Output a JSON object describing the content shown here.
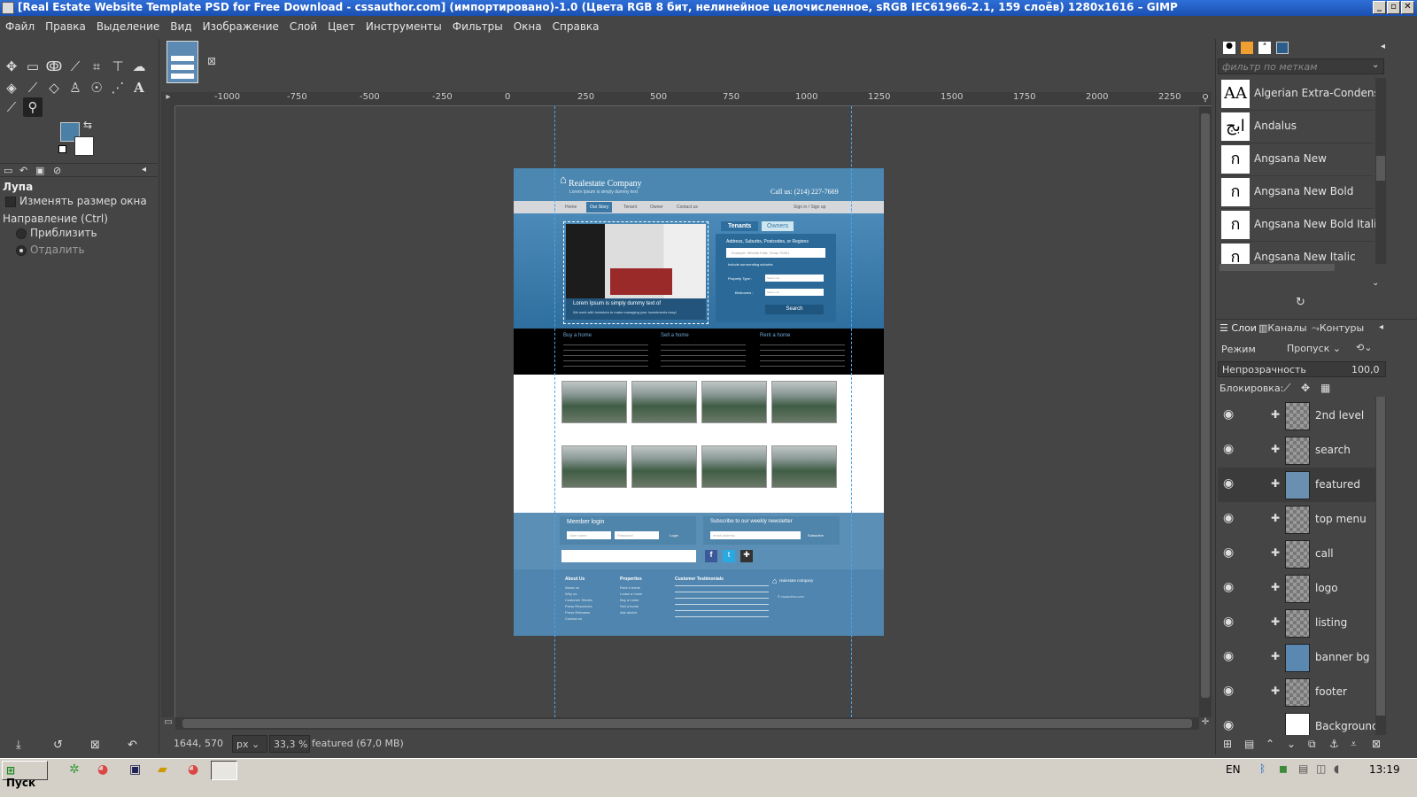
{
  "window": {
    "title": "[Real Estate Website Template PSD for Free Download - cssauthor.com] (импортировано)-1.0 (Цвета RGB 8 бит, нелинейное целочисленное, sRGB IEC61966-2.1, 159 слоёв) 1280x1616 – GIMP",
    "minimize_icon": "minimize-icon",
    "maximize_icon": "maximize-icon",
    "close_icon": "close-icon"
  },
  "menu": [
    "Файл",
    "Правка",
    "Выделение",
    "Вид",
    "Изображение",
    "Слой",
    "Цвет",
    "Инструменты",
    "Фильтры",
    "Окна",
    "Справка"
  ],
  "toolbox": {
    "colors": {
      "foreground": "#4a7fa6",
      "background": "#ffffff"
    }
  },
  "tool_options": {
    "title": "Лупа",
    "resize_window": "Изменять размер окна",
    "direction_label": "Направление  (Ctrl)",
    "zoom_in": "Приблизить",
    "zoom_out": "Отдалить"
  },
  "ruler": {
    "h_ticks": [
      "-1000",
      "-750",
      "-500",
      "-250",
      "0",
      "250",
      "500",
      "750",
      "1000",
      "1250",
      "1500",
      "1750",
      "2000",
      "2250"
    ]
  },
  "status": {
    "coords": "1644, 570",
    "unit": "px",
    "zoom": "33,3 %",
    "layer_info": "featured (67,0 MB)"
  },
  "fonts_panel": {
    "filter_placeholder": "фильтр по меткам",
    "fonts": [
      {
        "icon": "AA",
        "name": "Algerian Extra-Condensed"
      },
      {
        "icon": "ابج",
        "name": "Andalus"
      },
      {
        "icon": "ก",
        "name": "Angsana New"
      },
      {
        "icon": "ก",
        "name": "Angsana New Bold"
      },
      {
        "icon": "ก",
        "name": "Angsana New Bold Italic"
      },
      {
        "icon": "ก",
        "name": "Angsana New Italic"
      }
    ]
  },
  "layers_panel": {
    "tabs": [
      "Слои",
      "Каналы",
      "Контуры"
    ],
    "mode_label": "Режим",
    "mode_value": "Пропуск",
    "opacity_label": "Непрозрачность",
    "opacity_value": "100,0",
    "lock_label": "Блокировка:",
    "layers": [
      {
        "name": "2nd level",
        "selected": false
      },
      {
        "name": "search",
        "selected": false
      },
      {
        "name": "featured",
        "selected": true
      },
      {
        "name": "top menu",
        "selected": false
      },
      {
        "name": "call",
        "selected": false
      },
      {
        "name": "logo",
        "selected": false
      },
      {
        "name": "listing",
        "selected": false
      },
      {
        "name": "banner bg",
        "selected": false
      },
      {
        "name": "footer",
        "selected": false
      },
      {
        "name": "Background",
        "selected": false
      }
    ]
  },
  "document": {
    "company": "Realestate Company",
    "tagline": "Lorem Ipsum is simply dummy text",
    "call": "Call us: (214) 227-7669",
    "nav": [
      "Home",
      "Our Story",
      "Tenant",
      "Owner",
      "Contact us"
    ],
    "signin": "Sign in  /  Sign up",
    "banner_caption": "Lorem Ipsum is simply dummy text of",
    "banner_sub": "We work with investors to make managing your investments easy!",
    "search_tabs": [
      "Tenants",
      "Owners"
    ],
    "search_label": "Address, Suburbs, Postcodes, or Regions",
    "search_placeholder": "Example: Wichita Falls, Texas 76301",
    "include_label": "Include surrounding suburbs",
    "property_type": "Property Type :",
    "bedrooms": "Bedrooms :",
    "select_one": "Select one",
    "search_btn": "Search",
    "features": [
      "Buy a home",
      "Sell a home",
      "Rent a home"
    ],
    "member_login": "Member login",
    "user_name": "User name",
    "password": "Password",
    "login": "Login",
    "newsletter": "Subscribe to our weekly newsletter",
    "email": "email address",
    "subscribe": "Subscribe",
    "footer_cols": [
      {
        "title": "About Us",
        "items": [
          "About us",
          "Why us",
          "Customer Stories",
          "Press Resources",
          "Press Releases",
          "Contact us"
        ]
      },
      {
        "title": "Properties",
        "items": [
          "Rent a home",
          "Lease a home",
          "Buy a home",
          "Sell a home",
          "Ask advice"
        ]
      }
    ],
    "testimonials": "Customer Testimonials",
    "footer_logo": "realestate company",
    "copyright": "© cssauthor.com"
  },
  "taskbar": {
    "start": "Пуск",
    "lang": "EN",
    "clock": "13:19"
  }
}
